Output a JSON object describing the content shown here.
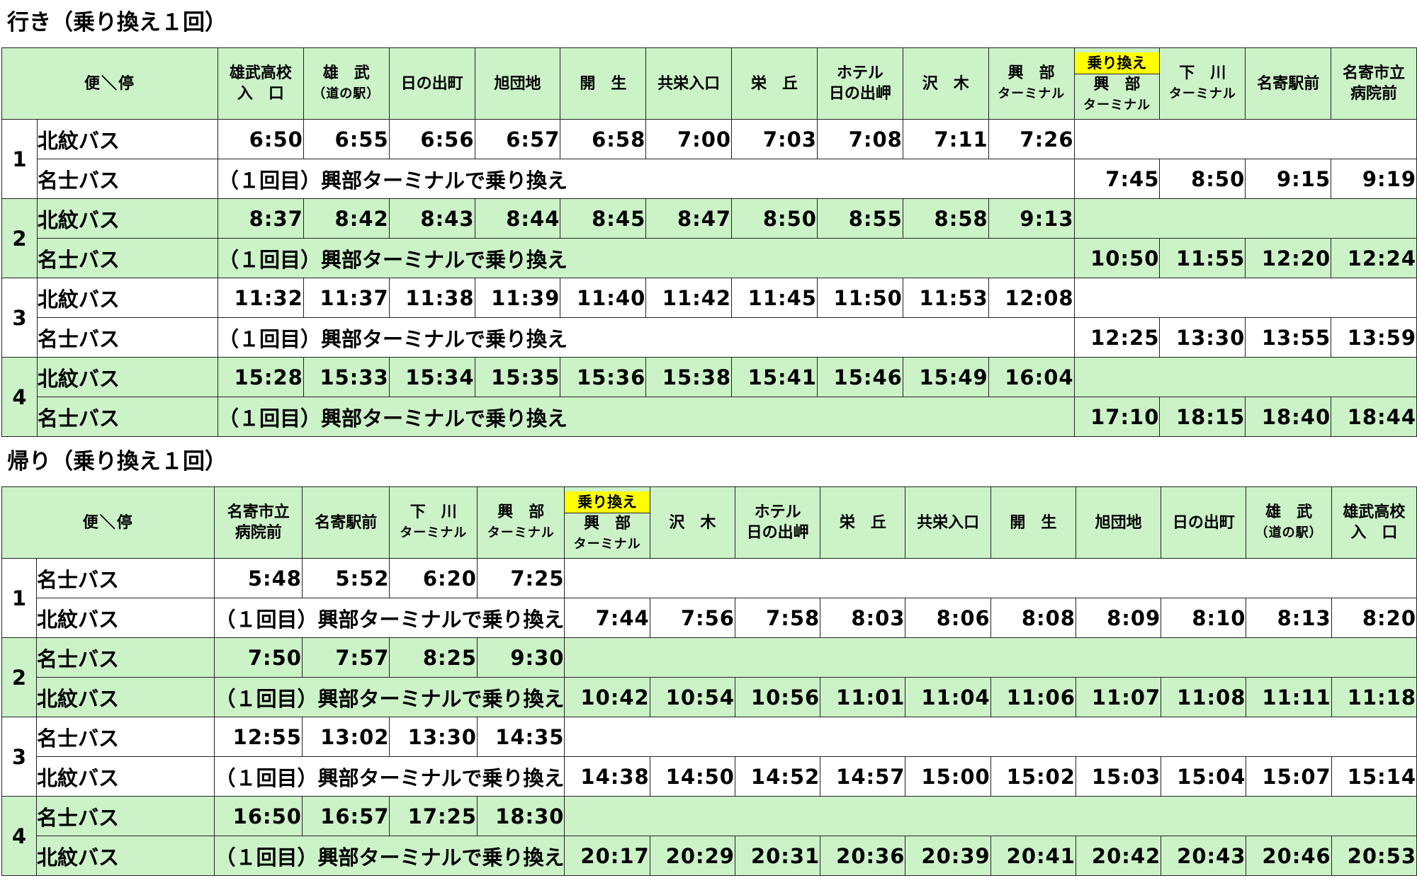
{
  "outbound": {
    "title": "行き（乗り換え１回）",
    "corner": "便＼停",
    "transfer_badge": "乗り換え",
    "transfer_note": "（１回目）興部ターミナルで乗り換え",
    "stops": [
      {
        "l1": "雄武高校",
        "l2": "入　口",
        "l3": ""
      },
      {
        "l1": "雄　武",
        "l2": "（道の駅）",
        "l3": ""
      },
      {
        "l1": "日の出町",
        "l2": "",
        "l3": ""
      },
      {
        "l1": "旭団地",
        "l2": "",
        "l3": ""
      },
      {
        "l1": "開　生",
        "l2": "",
        "l3": ""
      },
      {
        "l1": "共栄入口",
        "l2": "",
        "l3": ""
      },
      {
        "l1": "栄　丘",
        "l2": "",
        "l3": ""
      },
      {
        "l1": "ホテル",
        "l2": "日の出岬",
        "l3": ""
      },
      {
        "l1": "沢　木",
        "l2": "",
        "l3": ""
      },
      {
        "l1": "興　部",
        "l2": "ターミナル",
        "l3": ""
      },
      {
        "l1": "",
        "l2": "興　部",
        "l3": "ターミナル"
      },
      {
        "l1": "下　川",
        "l2": "ターミナル",
        "l3": ""
      },
      {
        "l1": "名寄駅前",
        "l2": "",
        "l3": ""
      },
      {
        "l1": "名寄市立",
        "l2": "病院前",
        "l3": ""
      }
    ],
    "trips": [
      {
        "no": "1",
        "op1": "北紋バス",
        "op2": "名士バス",
        "times1": [
          "6:50",
          "6:55",
          "6:56",
          "6:57",
          "6:58",
          "7:00",
          "7:03",
          "7:08",
          "7:11",
          "7:26"
        ],
        "times2": [
          "7:45",
          "8:50",
          "9:15",
          "9:19"
        ]
      },
      {
        "no": "2",
        "op1": "北紋バス",
        "op2": "名士バス",
        "times1": [
          "8:37",
          "8:42",
          "8:43",
          "8:44",
          "8:45",
          "8:47",
          "8:50",
          "8:55",
          "8:58",
          "9:13"
        ],
        "times2": [
          "10:50",
          "11:55",
          "12:20",
          "12:24"
        ]
      },
      {
        "no": "3",
        "op1": "北紋バス",
        "op2": "名士バス",
        "times1": [
          "11:32",
          "11:37",
          "11:38",
          "11:39",
          "11:40",
          "11:42",
          "11:45",
          "11:50",
          "11:53",
          "12:08"
        ],
        "times2": [
          "12:25",
          "13:30",
          "13:55",
          "13:59"
        ]
      },
      {
        "no": "4",
        "op1": "北紋バス",
        "op2": "名士バス",
        "times1": [
          "15:28",
          "15:33",
          "15:34",
          "15:35",
          "15:36",
          "15:38",
          "15:41",
          "15:46",
          "15:49",
          "16:04"
        ],
        "times2": [
          "17:10",
          "18:15",
          "18:40",
          "18:44"
        ]
      }
    ]
  },
  "return": {
    "title": "帰り（乗り換え１回）",
    "corner": "便＼停",
    "transfer_badge": "乗り換え",
    "transfer_note": "（１回目）興部ターミナルで乗り換え",
    "stops": [
      {
        "l1": "名寄市立",
        "l2": "病院前",
        "l3": ""
      },
      {
        "l1": "名寄駅前",
        "l2": "",
        "l3": ""
      },
      {
        "l1": "下　川",
        "l2": "ターミナル",
        "l3": ""
      },
      {
        "l1": "興　部",
        "l2": "ターミナル",
        "l3": ""
      },
      {
        "l1": "",
        "l2": "興　部",
        "l3": "ターミナル"
      },
      {
        "l1": "沢　木",
        "l2": "",
        "l3": ""
      },
      {
        "l1": "ホテル",
        "l2": "日の出岬",
        "l3": ""
      },
      {
        "l1": "栄　丘",
        "l2": "",
        "l3": ""
      },
      {
        "l1": "共栄入口",
        "l2": "",
        "l3": ""
      },
      {
        "l1": "開　生",
        "l2": "",
        "l3": ""
      },
      {
        "l1": "旭団地",
        "l2": "",
        "l3": ""
      },
      {
        "l1": "日の出町",
        "l2": "",
        "l3": ""
      },
      {
        "l1": "雄　武",
        "l2": "（道の駅）",
        "l3": ""
      },
      {
        "l1": "雄武高校",
        "l2": "入　口",
        "l3": ""
      }
    ],
    "trips": [
      {
        "no": "1",
        "op1": "名士バス",
        "op2": "北紋バス",
        "times1": [
          "5:48",
          "5:52",
          "6:20",
          "7:25"
        ],
        "times2": [
          "7:44",
          "7:56",
          "7:58",
          "8:03",
          "8:06",
          "8:08",
          "8:09",
          "8:10",
          "8:13",
          "8:20"
        ]
      },
      {
        "no": "2",
        "op1": "名士バス",
        "op2": "北紋バス",
        "times1": [
          "7:50",
          "7:57",
          "8:25",
          "9:30"
        ],
        "times2": [
          "10:42",
          "10:54",
          "10:56",
          "11:01",
          "11:04",
          "11:06",
          "11:07",
          "11:08",
          "11:11",
          "11:18"
        ]
      },
      {
        "no": "3",
        "op1": "名士バス",
        "op2": "北紋バス",
        "times1": [
          "12:55",
          "13:02",
          "13:30",
          "14:35"
        ],
        "times2": [
          "14:38",
          "14:50",
          "14:52",
          "14:57",
          "15:00",
          "15:02",
          "15:03",
          "15:04",
          "15:07",
          "15:14"
        ]
      },
      {
        "no": "4",
        "op1": "名士バス",
        "op2": "北紋バス",
        "times1": [
          "16:50",
          "16:57",
          "17:25",
          "18:30"
        ],
        "times2": [
          "20:17",
          "20:29",
          "20:31",
          "20:36",
          "20:39",
          "20:41",
          "20:42",
          "20:43",
          "20:46",
          "20:53"
        ]
      }
    ]
  }
}
